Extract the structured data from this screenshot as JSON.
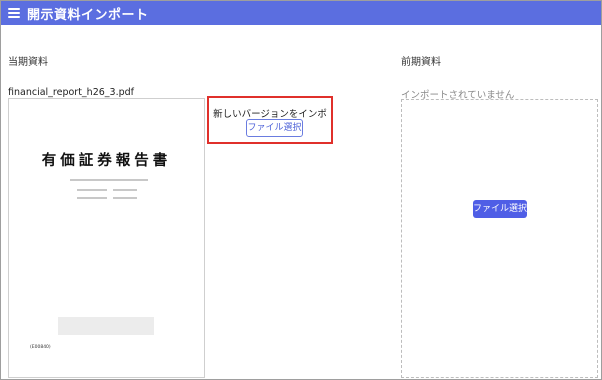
{
  "app": {
    "title": "開示資料インポート"
  },
  "current": {
    "heading": "当期資料",
    "filename": "financial_report_h26_3.pdf",
    "preview": {
      "title": "有価証券報告書",
      "code": "(E00840)"
    },
    "import_label": "新しいバージョンをインポート",
    "select_file_label": "ファイル選択"
  },
  "previous": {
    "heading": "前期資料",
    "status": "インポートされていません",
    "select_file_label": "ファイル選択"
  },
  "colors": {
    "appbar": "#5b6ee0",
    "accent": "#4f5ee6",
    "highlight": "#e0302b"
  }
}
